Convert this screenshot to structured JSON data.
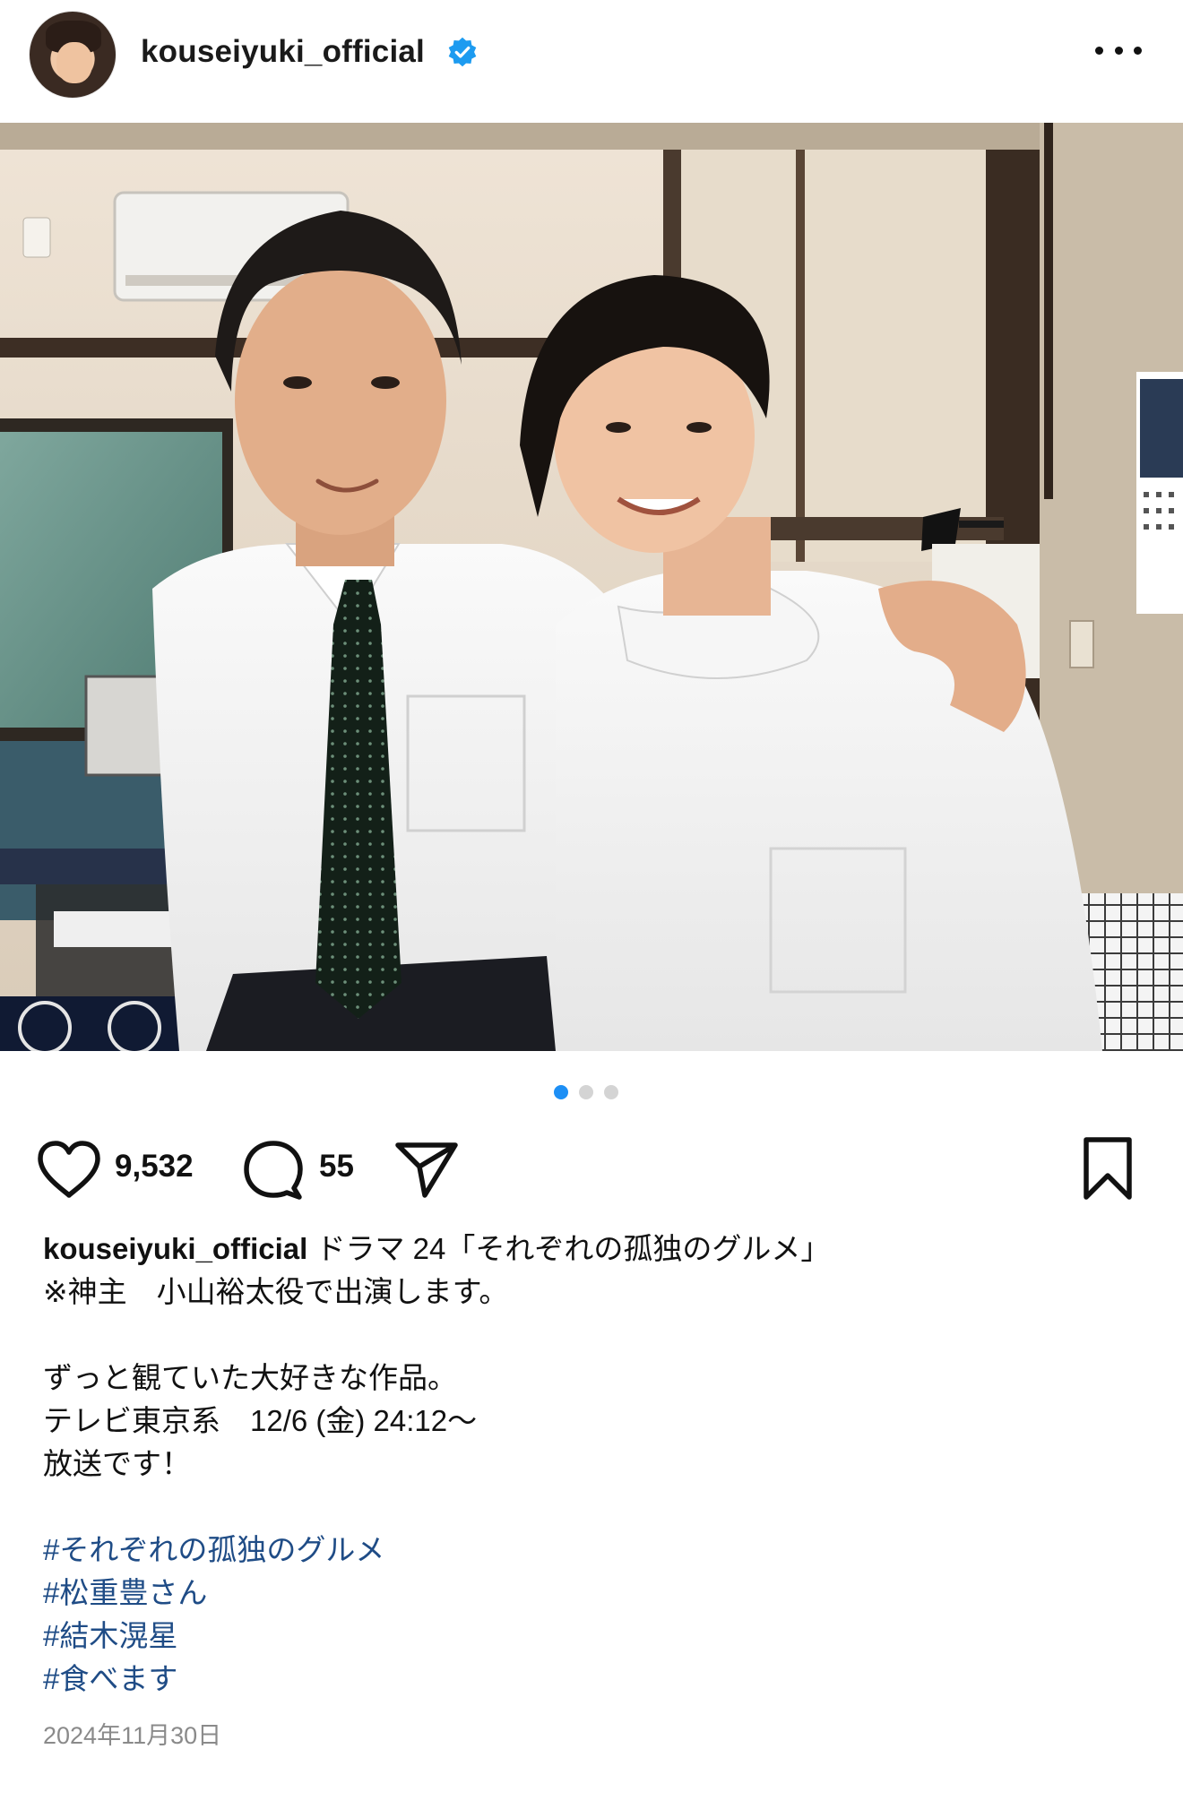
{
  "header": {
    "username": "kouseiyuki_official",
    "verified": true
  },
  "carousel": {
    "total": 3,
    "active_index": 0
  },
  "actions": {
    "likes": "9,532",
    "comments": "55"
  },
  "caption": {
    "owner": "kouseiyuki_official",
    "first_line": " ドラマ 24「それぞれの孤独のグルメ」",
    "lines": [
      "※神主　小山裕太役で出演します。",
      "",
      "ずっと観ていた大好きな作品。",
      "テレビ東京系　12/6 (金) 24:12〜",
      "放送です！",
      ""
    ],
    "hashtags": [
      "#それぞれの孤独のグルメ",
      "#松重豊さん",
      "#結木滉星",
      "#食べます"
    ]
  },
  "date": "2024年11月30日",
  "colors": {
    "hashtag": "#1f4c86",
    "verified_badge": "#1d9bf0",
    "carousel_active": "#1d8ff5",
    "carousel_inactive": "#d4d4d4"
  }
}
